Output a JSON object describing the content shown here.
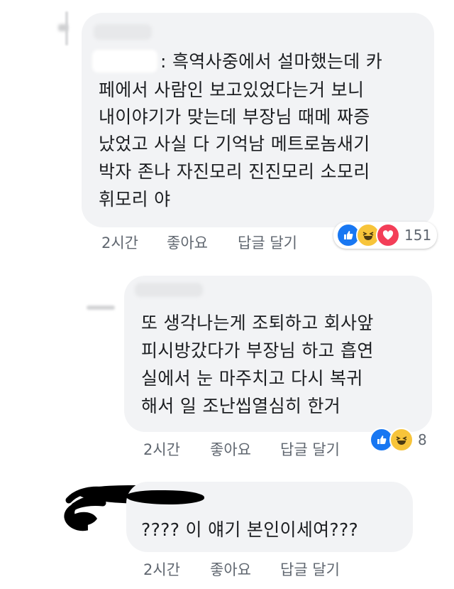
{
  "comments": [
    {
      "text_lines": [
        ": 흑역사중에서 설마했는데 카",
        "페에서 사람인 보고있었다는거 보니",
        "내이야기가 맞는데 부장님 때메 짜증",
        "났었고 사실 다 기억남 메트로놈새기",
        "박자 존나 자진모리 진진모리 소모리",
        "휘모리 야"
      ],
      "time": "2시간",
      "like_label": "좋아요",
      "reply_label": "답글 달기",
      "reaction_count": "151",
      "reaction_icons": [
        "like-icon",
        "haha-icon",
        "love-icon"
      ]
    },
    {
      "text_lines": [
        "또 생각나는게 조퇴하고 회사앞",
        "피시방갔다가 부장님 하고 흡연",
        "실에서 눈 마주치고 다시 복귀",
        "해서 일 조난씹열심히 한거"
      ],
      "time": "2시간",
      "like_label": "좋아요",
      "reply_label": "답글 달기",
      "reaction_count": "8",
      "reaction_icons": [
        "like-icon",
        "haha-icon"
      ]
    },
    {
      "text_lines": [
        "???? 이 얘기 본인이세여???"
      ],
      "time": "2시간",
      "like_label": "좋아요",
      "reply_label": "답글 달기"
    }
  ],
  "colors": {
    "bubble": "#f2f3f5",
    "meta_text": "#606770",
    "like": "#1877f2",
    "haha": "#f7c43a",
    "love": "#f33e58"
  }
}
